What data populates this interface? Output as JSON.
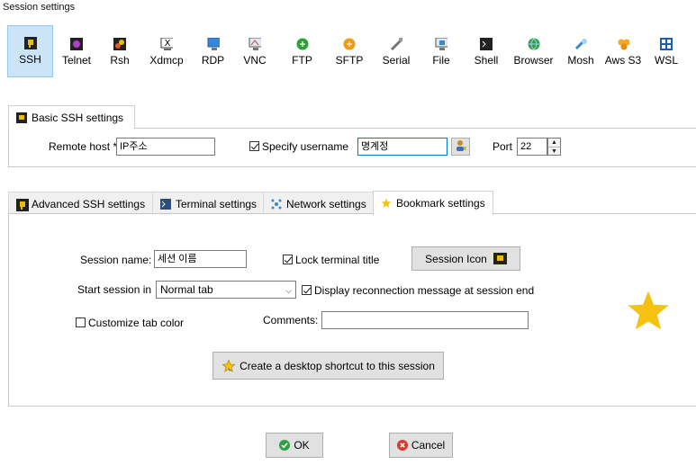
{
  "window": {
    "title": "Session settings"
  },
  "session_types": [
    {
      "label": "SSH",
      "icon": "ssh-icon",
      "active": true
    },
    {
      "label": "Telnet",
      "icon": "telnet-icon",
      "active": false
    },
    {
      "label": "Rsh",
      "icon": "rsh-icon",
      "active": false
    },
    {
      "label": "Xdmcp",
      "icon": "xdmcp-icon",
      "active": false
    },
    {
      "label": "RDP",
      "icon": "rdp-icon",
      "active": false
    },
    {
      "label": "VNC",
      "icon": "vnc-icon",
      "active": false
    },
    {
      "label": "FTP",
      "icon": "ftp-icon",
      "active": false
    },
    {
      "label": "SFTP",
      "icon": "sftp-icon",
      "active": false
    },
    {
      "label": "Serial",
      "icon": "serial-icon",
      "active": false
    },
    {
      "label": "File",
      "icon": "file-icon",
      "active": false
    },
    {
      "label": "Shell",
      "icon": "shell-icon",
      "active": false
    },
    {
      "label": "Browser",
      "icon": "browser-icon",
      "active": false
    },
    {
      "label": "Mosh",
      "icon": "mosh-icon",
      "active": false
    },
    {
      "label": "Aws S3",
      "icon": "aws-s3-icon",
      "active": false
    },
    {
      "label": "WSL",
      "icon": "wsl-icon",
      "active": false
    }
  ],
  "basic": {
    "tab_label": "Basic SSH settings",
    "remote_host_label": "Remote host *",
    "remote_host_value": "IP주소",
    "specify_username_label": "Specify username",
    "specify_username_checked": true,
    "username_value": "명계정",
    "port_label": "Port",
    "port_value": "22"
  },
  "tabs": [
    {
      "label": "Advanced SSH settings",
      "icon": "ssh-icon",
      "selected": false
    },
    {
      "label": "Terminal settings",
      "icon": "terminal-icon",
      "selected": false
    },
    {
      "label": "Network settings",
      "icon": "network-icon",
      "selected": false
    },
    {
      "label": "Bookmark settings",
      "icon": "star-icon",
      "selected": true
    }
  ],
  "bookmark": {
    "session_name_label": "Session name:",
    "session_name_value": "세션 이름",
    "lock_title_label": "Lock terminal title",
    "lock_title_checked": true,
    "session_icon_label": "Session Icon",
    "start_session_label": "Start session in",
    "start_session_value": "Normal tab",
    "display_reconnect_label": "Display reconnection message at session end",
    "display_reconnect_checked": true,
    "customize_color_label": "Customize tab color",
    "customize_color_checked": false,
    "comments_label": "Comments:",
    "comments_value": "",
    "shortcut_label": "Create a desktop shortcut to this session"
  },
  "footer": {
    "ok_label": "OK",
    "cancel_label": "Cancel"
  },
  "colors": {
    "accent": "#0078d7",
    "active_bg": "#cce4f7",
    "star": "#f5c211",
    "ok_green": "#2ea043",
    "cancel_red": "#d9382c"
  }
}
